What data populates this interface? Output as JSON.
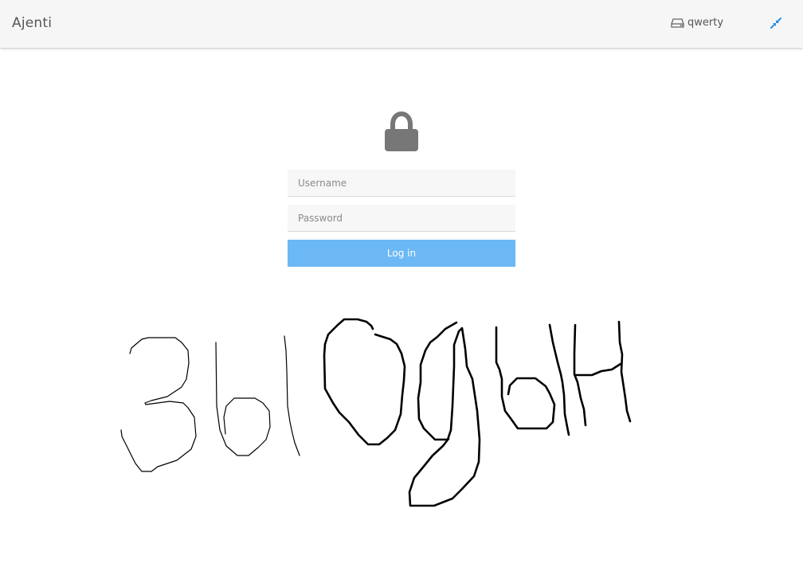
{
  "header": {
    "brand": "Ajenti",
    "host_name": "qwerty",
    "host_icon": "hdd-icon",
    "compress_icon": "compress-icon"
  },
  "login": {
    "lock_icon": "lock-icon",
    "username_placeholder": "Username",
    "password_placeholder": "Password",
    "login_label": "Log in"
  },
  "colors": {
    "accent": "#6cb8f5",
    "compress_icon": "#2a8fe0",
    "lock": "#777777",
    "topbar_bg": "#f6f6f6"
  },
  "drawing": {
    "description_text": "",
    "icon": "handwriting-drawing"
  }
}
